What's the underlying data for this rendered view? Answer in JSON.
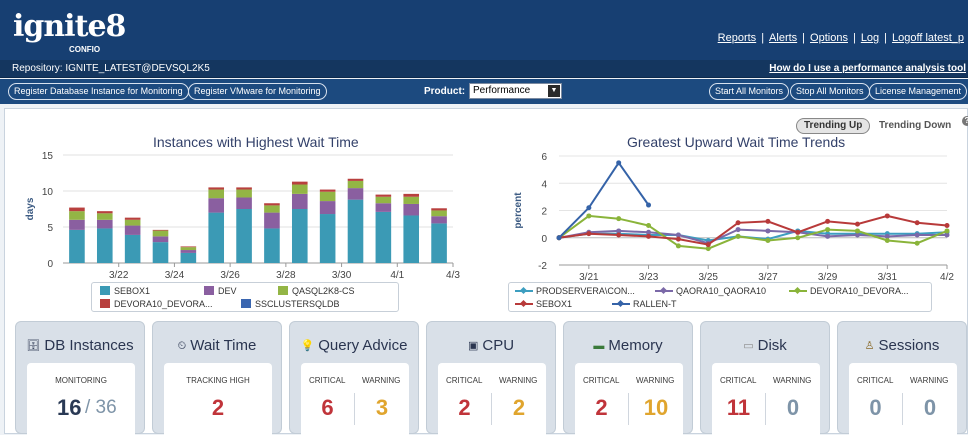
{
  "header": {
    "logo_word": "ignite8",
    "logo_sub": "CONFIO",
    "links": [
      "Reports",
      "Alerts",
      "Options",
      "Log",
      "Logoff latest_p"
    ],
    "repository": "Repository: IGNITE_LATEST@DEVSQL2K5",
    "help_link": "How do I use a performance analysis tool"
  },
  "actions": {
    "register_db": "Register Database Instance for Monitoring",
    "register_vmware": "Register VMware for Monitoring",
    "product_label": "Product:",
    "product_value": "Performance",
    "start_all": "Start All Monitors",
    "stop_all": "Stop All Monitors",
    "license": "License Management"
  },
  "trend_tabs": {
    "up": "Trending Up",
    "down": "Trending Down",
    "help": "?"
  },
  "chart_data": [
    {
      "type": "bar",
      "stacked": true,
      "title": "Instances with Highest Wait Time",
      "ylabel": "days",
      "ylim": [
        0,
        15
      ],
      "yticks": [
        0,
        5,
        10,
        15
      ],
      "x_tick_labels": [
        "3/22",
        "3/24",
        "3/26",
        "3/28",
        "3/30",
        "4/1",
        "4/3"
      ],
      "x_tick_indices": [
        1.5,
        3.5,
        5.5,
        7.5,
        9.5,
        11.5,
        13.5
      ],
      "categories": [
        "3/21",
        "3/22",
        "3/23",
        "3/24",
        "3/25",
        "3/26",
        "3/27",
        "3/28",
        "3/29",
        "3/30",
        "3/31",
        "4/1",
        "4/2",
        "4/3"
      ],
      "series": [
        {
          "name": "SEBOX1",
          "color": "#3b9ab5",
          "values": [
            4.6,
            4.8,
            3.9,
            2.9,
            1.4,
            7.0,
            7.5,
            4.8,
            7.5,
            6.8,
            8.8,
            7.1,
            6.6,
            5.5
          ]
        },
        {
          "name": "DEV",
          "color": "#8a5fa0",
          "values": [
            1.4,
            1.2,
            1.3,
            0.8,
            0.4,
            2.0,
            1.6,
            2.2,
            2.1,
            1.8,
            1.6,
            1.2,
            1.6,
            1.0
          ]
        },
        {
          "name": "QASQL2K8-CS",
          "color": "#93b545",
          "values": [
            1.2,
            0.9,
            0.8,
            0.8,
            0.4,
            1.2,
            1.1,
            1.0,
            1.3,
            1.3,
            1.0,
            0.9,
            1.0,
            0.8
          ]
        },
        {
          "name": "DEVORA10_DEVORA...",
          "color": "#b8403e",
          "values": [
            0.5,
            0.3,
            0.3,
            0.1,
            0.1,
            0.3,
            0.3,
            0.3,
            0.4,
            0.3,
            0.3,
            0.3,
            0.4,
            0.3
          ]
        },
        {
          "name": "SSCLUSTERSQLDB",
          "color": "#3a66b0",
          "values": [
            0,
            0,
            0,
            0,
            0,
            0,
            0,
            0,
            0,
            0,
            0,
            0,
            0,
            0
          ]
        }
      ]
    },
    {
      "type": "line",
      "title": "Greatest Upward Wait Time Trends",
      "ylabel": "percent",
      "ylim": [
        -2,
        6
      ],
      "yticks": [
        -2,
        0,
        2,
        4,
        6
      ],
      "x_tick_labels": [
        "3/21",
        "3/23",
        "3/25",
        "3/27",
        "3/29",
        "3/31",
        "4/2"
      ],
      "x_tick_indices": [
        1,
        3,
        5,
        7,
        9,
        11,
        13
      ],
      "categories": [
        "3/20",
        "3/21",
        "3/22",
        "3/23",
        "3/24",
        "3/25",
        "3/26",
        "3/27",
        "3/28",
        "3/29",
        "3/30",
        "3/31",
        "4/1",
        "4/2"
      ],
      "series": [
        {
          "name": "PRODSERVERA\\CON...",
          "color": "#3d9ec0",
          "values": [
            0,
            0.3,
            0.3,
            0.2,
            0.2,
            -0.2,
            0.1,
            -0.1,
            0.5,
            0.3,
            0.3,
            0.3,
            0.3,
            0.4
          ]
        },
        {
          "name": "QAORA10_QAORA10",
          "color": "#7b69a8",
          "values": [
            0,
            0.4,
            0.5,
            0.4,
            0.2,
            -0.4,
            0.6,
            0.5,
            0.4,
            0.1,
            0.2,
            0.1,
            0.2,
            0.2
          ]
        },
        {
          "name": "DEVORA10_DEVORA...",
          "color": "#8ab43a",
          "values": [
            0,
            1.6,
            1.4,
            0.9,
            -0.6,
            -0.8,
            0.1,
            -0.2,
            0.0,
            0.6,
            0.5,
            -0.2,
            -0.4,
            0.5
          ]
        },
        {
          "name": "SEBOX1",
          "color": "#b83a3a",
          "values": [
            0,
            0.3,
            0.2,
            0.1,
            -0.1,
            -0.5,
            1.1,
            1.2,
            0.4,
            1.2,
            1.0,
            1.6,
            1.1,
            0.9
          ]
        },
        {
          "name": "RALLEN-T",
          "color": "#3563a8",
          "values": [
            0,
            2.2,
            5.5,
            2.4,
            null,
            null,
            null,
            null,
            null,
            null,
            null,
            null,
            null,
            null
          ]
        }
      ]
    }
  ],
  "cards": [
    {
      "title": "DB Instances",
      "icon": "database-icon",
      "label1": "MONITORING",
      "value1": "16",
      "value2": "/ 36"
    },
    {
      "title": "Wait Time",
      "icon": "clock-icon",
      "label1": "TRACKING HIGH",
      "value1": "2"
    },
    {
      "title": "Query Advice",
      "icon": "lightbulb-icon",
      "label1": "CRITICAL",
      "label2": "WARNING",
      "value1": "6",
      "value2": "3"
    },
    {
      "title": "CPU",
      "icon": "chip-icon",
      "label1": "CRITICAL",
      "label2": "WARNING",
      "value1": "2",
      "value2": "2"
    },
    {
      "title": "Memory",
      "icon": "memory-icon",
      "label1": "CRITICAL",
      "label2": "WARNING",
      "value1": "2",
      "value2": "10"
    },
    {
      "title": "Disk",
      "icon": "disk-icon",
      "label1": "CRITICAL",
      "label2": "WARNING",
      "value1": "11",
      "value2": "0"
    },
    {
      "title": "Sessions",
      "icon": "user-icon",
      "label1": "CRITICAL",
      "label2": "WARNING",
      "value1": "0",
      "value2": "0"
    }
  ],
  "colors": {
    "critical": "#c0343a",
    "warning": "#e0a52e",
    "neutral": "#7e94a8",
    "dark": "#2a3a55",
    "header": "#173f72"
  }
}
